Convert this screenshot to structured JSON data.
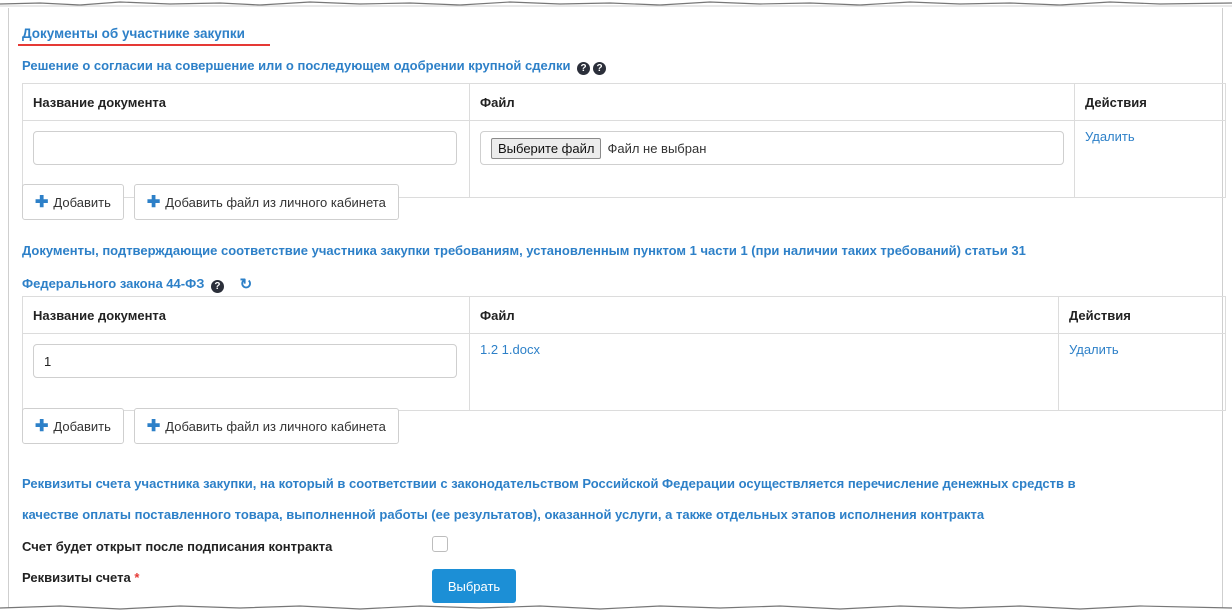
{
  "section_title": "Документы об участнике закупки",
  "consent_heading": "Решение о согласии на совершение или о последующем одобрении крупной сделки",
  "table_headers": {
    "name": "Название документа",
    "file": "Файл",
    "actions": "Действия"
  },
  "table1": {
    "rows": [
      {
        "name_value": "",
        "choose_file_label": "Выберите файл",
        "file_status": "Файл не выбран",
        "action": "Удалить"
      }
    ]
  },
  "buttons": {
    "add": "Добавить",
    "add_from_cabinet": "Добавить файл из личного кабинета"
  },
  "requirements_heading": {
    "line1": "Документы, подтверждающие соответствие участника закупки требованиям, установленным пунктом 1 части 1 (при наличии таких требований) статьи 31",
    "line2": "Федерального закона 44-ФЗ"
  },
  "table2": {
    "rows": [
      {
        "name_value": "1",
        "file_name": "1.2 1.docx",
        "action": "Удалить"
      }
    ]
  },
  "account_heading": {
    "line1": "Реквизиты счета участника закупки, на который в соответствии с законодательством Российской Федерации осуществляется перечисление денежных средств в",
    "line2": "качестве оплаты поставленного товара, выполненной работы (ее результатов), оказанной услуги, а также отдельных этапов исполнения контракта"
  },
  "account_open_label": "Счет будет открыт после подписания контракта",
  "account_open_checked": false,
  "account_details_label": "Реквизиты счета",
  "required_mark": "*",
  "select_button": "Выбрать",
  "colors": {
    "accent": "#2d80c8",
    "primary_button": "#1c8fd6",
    "required": "#e53935",
    "underline": "#e53935"
  }
}
